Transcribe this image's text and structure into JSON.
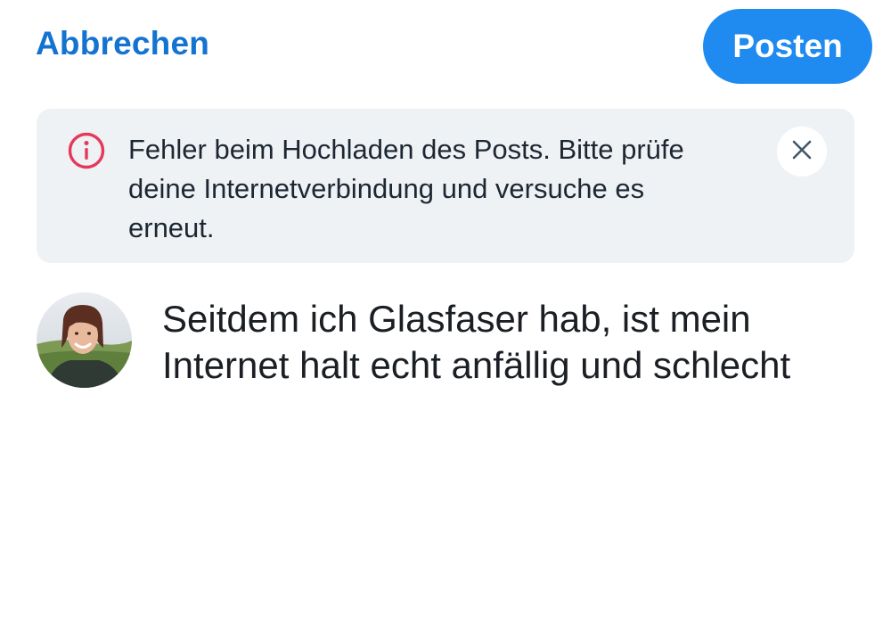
{
  "header": {
    "cancel_label": "Abbrechen",
    "post_label": "Posten"
  },
  "error_banner": {
    "message": "Fehler beim Hochladen des Posts. Bitte prüfe deine Internetverbindung und versuche es erneut.",
    "icon": "info-circle-icon",
    "dismiss_icon": "close-icon",
    "icon_color": "#e5385c"
  },
  "composer": {
    "avatar": "user-avatar-photo",
    "text": "Seitdem ich Glasfaser hab, ist mein Internet halt echt anfällig und schlecht"
  },
  "colors": {
    "accent": "#1473d1",
    "button": "#1f8af0",
    "banner_bg": "#eff2f4"
  }
}
